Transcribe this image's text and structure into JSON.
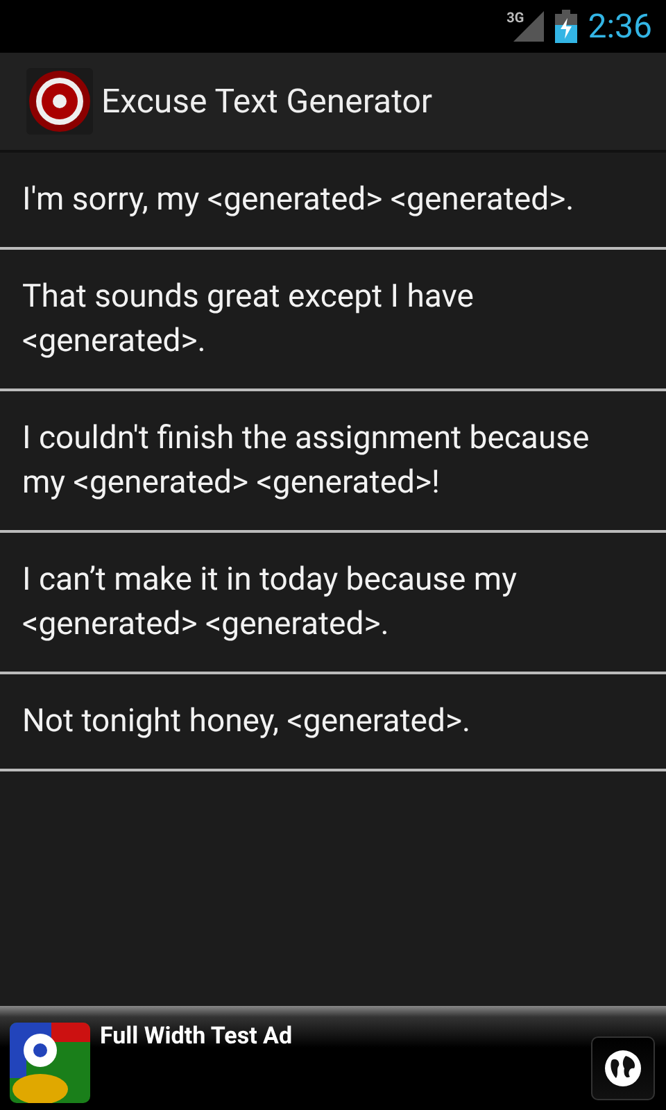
{
  "status_bar": {
    "network": "3G",
    "time": "2:36"
  },
  "action_bar": {
    "title": "Excuse Text Generator"
  },
  "excuses": [
    {
      "text": "I'm sorry, my <generated> <generated>."
    },
    {
      "text": "That sounds great except I have <generated>."
    },
    {
      "text": "I couldn't finish the assignment because my <generated> <generated>!"
    },
    {
      "text": "I can’t make it in today because my <generated> <generated>."
    },
    {
      "text": "Not tonight honey, <generated>."
    }
  ],
  "ad": {
    "title": "Full Width Test Ad"
  }
}
